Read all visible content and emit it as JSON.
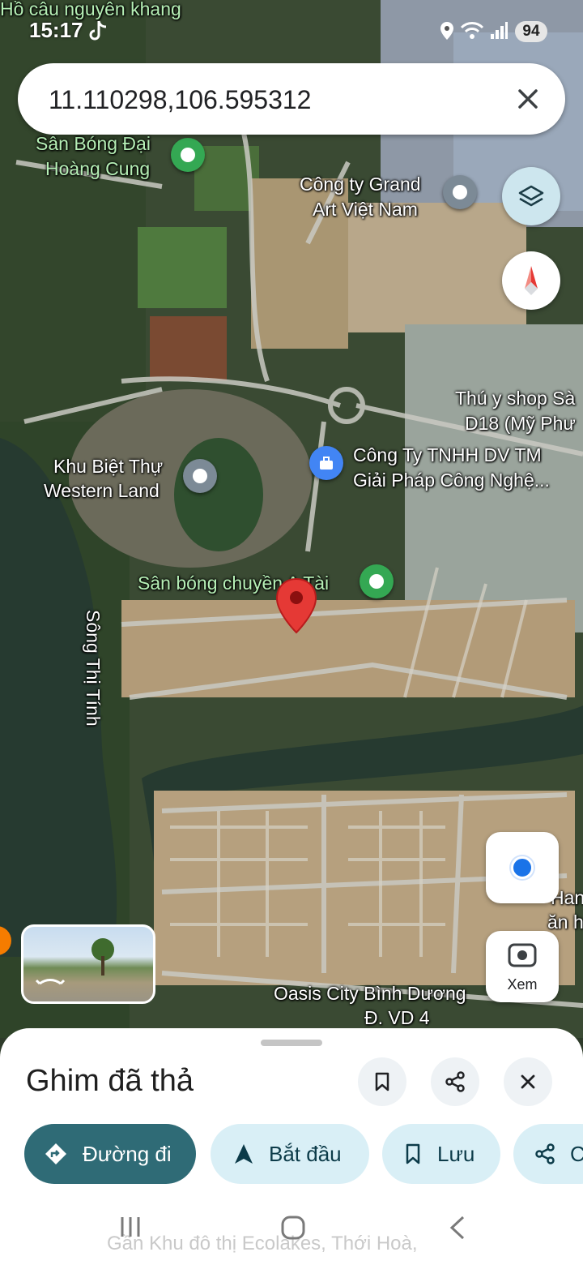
{
  "status_bar": {
    "time": "15:17",
    "battery": "94",
    "top_cut_label": "Hồ câu nguyên khang"
  },
  "search": {
    "value": "11.110298,106.595312"
  },
  "map_labels": {
    "san_bong_dai": [
      "Sân Bóng Đại",
      "Hoàng Cung"
    ],
    "grand_art": [
      "Công ty Grand",
      "Art Việt Nam"
    ],
    "thu_y": [
      "Thú y shop Sà",
      "D18 (Mỹ Phư"
    ],
    "tnhh": [
      "Công Ty TNHH DV TM",
      "Giải Pháp Công Nghệ..."
    ],
    "biet_thu": [
      "Khu Biệt Thự",
      "Western Land"
    ],
    "san_bong_chuyen": "Sân bóng chuyền A Tài",
    "song": "Sông Thị Tính",
    "oasis": "Oasis City Bình Dương",
    "road": "Đ. VD 4",
    "han": [
      "Han",
      "ăn h"
    ]
  },
  "lens": {
    "label": "Xem"
  },
  "sheet": {
    "title": "Ghim đã thả",
    "actions": {
      "directions": "Đường đi",
      "start": "Bắt đầu",
      "save": "Lưu",
      "share": "C"
    },
    "behind_text": "Gần Khu đô thị Ecolakes, Thới Hoà,"
  },
  "colors": {
    "primary_pill": "#2f6b76",
    "light_pill": "#d9eff6",
    "pin_red": "#e53935",
    "place_green": "#34a853",
    "place_gray": "#7c8a96",
    "place_blue": "#4285f4"
  }
}
